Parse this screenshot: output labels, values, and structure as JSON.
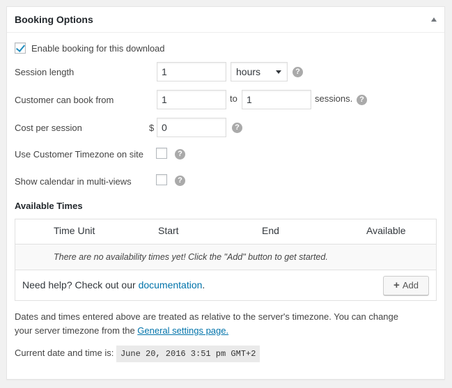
{
  "panel": {
    "title": "Booking Options"
  },
  "enable_booking": {
    "label": "Enable booking for this download",
    "checked": true
  },
  "session_length": {
    "label": "Session length",
    "value": "1",
    "unit_selected": "hours",
    "help": "?"
  },
  "customer_book_from": {
    "label": "Customer can book from",
    "from_value": "1",
    "to_label": "to",
    "to_value": "1",
    "suffix": "sessions.",
    "help": "?"
  },
  "cost_per_session": {
    "label": "Cost per session",
    "currency": "$",
    "value": "0",
    "help": "?"
  },
  "use_customer_timezone": {
    "label": "Use Customer Timezone on site",
    "checked": false,
    "help": "?"
  },
  "show_calendar": {
    "label": "Show calendar in multi-views",
    "checked": false,
    "help": "?"
  },
  "available_times": {
    "title": "Available Times",
    "columns": [
      "Time Unit",
      "Start",
      "End",
      "Available"
    ],
    "empty_message": "There are no availability times yet! Click the \"Add\" button to get started.",
    "help_prefix": "Need help? Check out our ",
    "help_link": "documentation",
    "help_suffix": ".",
    "add_button": "Add"
  },
  "notes": {
    "timezone_line1": "Dates and times entered above are treated as relative to the server's timezone. You can change",
    "timezone_line2_prefix": "your server timezone from the ",
    "timezone_link": "General settings page.",
    "current_label": "Current date and time is:",
    "current_value": "June 20, 2016 3:51 pm GMT+2"
  },
  "colors": {
    "link": "#0073aa",
    "checkmark": "#1e8cbe"
  }
}
